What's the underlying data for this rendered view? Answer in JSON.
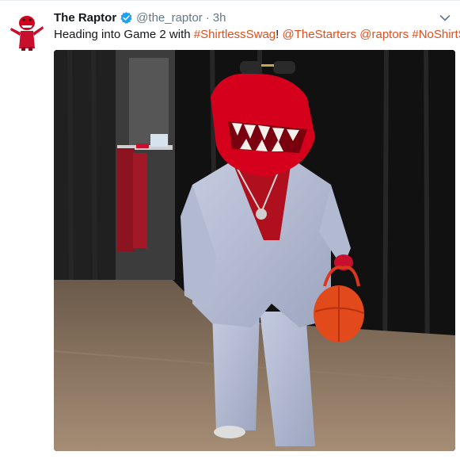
{
  "tweet": {
    "author": {
      "name": "The Raptor",
      "handle": "@the_raptor",
      "verified": true,
      "avatar_icon": "raptor-mascot-avatar"
    },
    "separator": "·",
    "time": "3h",
    "menu_icon": "chevron-down-icon",
    "text": {
      "prefix": "Heading into Game 2 with ",
      "hashtag_shirtless_swag": "#ShirtlessSwag",
      "exclamation": "!",
      "space1": " ",
      "mention_thestarters": "@TheStarters",
      "space2": " ",
      "mention_raptors": "@raptors",
      "space3": " ",
      "hashtag_noshirtszn": "#NoShirtSzn"
    },
    "media": {
      "type": "photo"
    },
    "colors": {
      "link": "#e0501e",
      "verified_badge": "#1da1f2",
      "secondary_text": "#657786"
    }
  }
}
